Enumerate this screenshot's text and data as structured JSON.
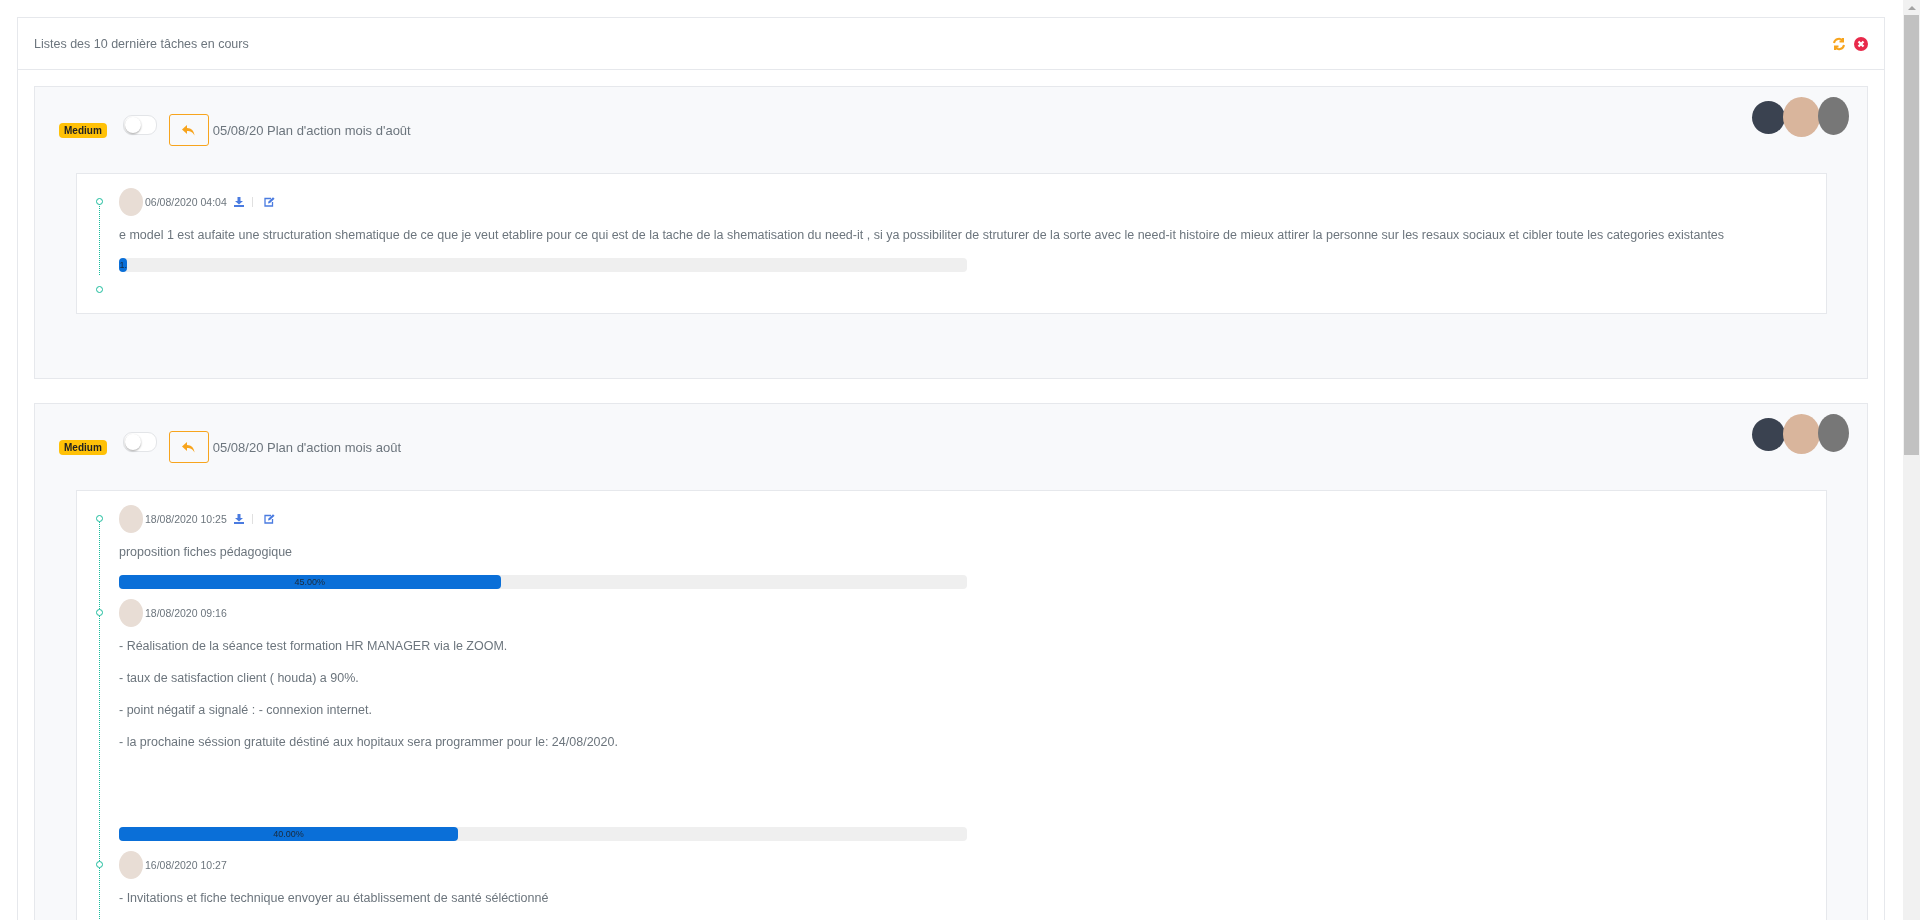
{
  "panel": {
    "title": "Listes des 10 dernière tâches en cours",
    "actions": [
      {
        "kind": "refresh"
      },
      {
        "kind": "close"
      }
    ]
  },
  "tasks": [
    {
      "priority": "Medium",
      "toggle_on": false,
      "title": "05/08/20 Plan d'action mois d'août",
      "timeline_end": true,
      "entries": [
        {
          "date": "06/08/2020 04:04",
          "actions": [
            {
              "kind": "download"
            },
            {
              "kind": "edit"
            }
          ],
          "paragraphs": [
            "e model 1 est aufaite une structuration shematique de ce que je veut etablire pour ce qui est de la tache de la shematisation du need-it , si ya possibiliter de struturer de la sorte avec le need-it histoire de mieux attirer la personne sur les resaux sociaux et cibler toute les categories existantes"
          ],
          "progress": {
            "level": 0.01,
            "label": "1."
          }
        }
      ]
    },
    {
      "priority": "Medium",
      "toggle_on": false,
      "title": "05/08/20 Plan d'action mois août",
      "timeline_end": false,
      "entries": [
        {
          "date": "18/08/2020 10:25",
          "actions": [
            {
              "kind": "download"
            },
            {
              "kind": "edit"
            }
          ],
          "paragraphs": [
            "proposition fiches pédagogique"
          ],
          "progress": {
            "level": 0.45,
            "label": "45.00%"
          }
        },
        {
          "date": "18/08/2020 09:16",
          "paragraphs": [
            "- Réalisation de la séance test formation HR MANAGER via le ZOOM.",
            "- taux de satisfaction client ( houda) a 90%.",
            "- point négatif a signalé : - connexion internet.",
            "- la prochaine séssion gratuite déstiné aux hopitaux sera programmer pour le: 24/08/2020."
          ],
          "progress": {
            "level": 0.4,
            "label": "40.00%"
          }
        },
        {
          "date": "16/08/2020 10:27",
          "paragraphs": [
            "- Invitations et fiche technique envoyer au établissement de santé séléctionné"
          ]
        }
      ]
    }
  ]
}
